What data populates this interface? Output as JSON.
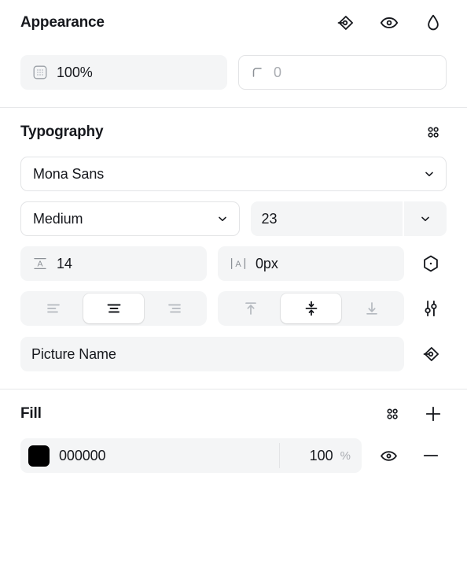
{
  "appearance": {
    "title": "Appearance",
    "actions": [
      {
        "name": "variable-icon",
        "label": "variable-token"
      },
      {
        "name": "eye-icon",
        "label": "visibility"
      },
      {
        "name": "droplet-icon",
        "label": "blend"
      }
    ],
    "opacity": {
      "icon": "opacity-grid-icon",
      "value": "100%"
    },
    "corner_radius": {
      "icon": "corner-radius-icon",
      "value": "0"
    }
  },
  "typography": {
    "title": "Typography",
    "actions": [
      {
        "name": "four-dot-grid-icon",
        "label": "styles"
      }
    ],
    "font_family": {
      "value": "Mona Sans",
      "chevron": "chevron-down-icon"
    },
    "font_weight": {
      "value": "Medium",
      "chevron": "chevron-down-icon"
    },
    "font_size": {
      "value": "23",
      "chevron": "chevron-down-icon"
    },
    "line_height": {
      "icon": "line-height-icon",
      "value": "14"
    },
    "letter_spacing": {
      "icon": "letter-spacing-icon",
      "value": "0px"
    },
    "type_settings_icon": "hexagon-dot-icon",
    "align_horizontal": {
      "options": [
        {
          "name": "align-left",
          "label": "Left"
        },
        {
          "name": "align-center",
          "label": "Center"
        },
        {
          "name": "align-right",
          "label": "Right"
        }
      ],
      "selected": 1
    },
    "align_vertical": {
      "options": [
        {
          "name": "align-top",
          "label": "Top"
        },
        {
          "name": "align-middle",
          "label": "Middle"
        },
        {
          "name": "align-bottom",
          "label": "Bottom"
        }
      ],
      "selected": 1
    },
    "align_settings_icon": "sliders-icon",
    "text_content": {
      "value": "Picture Name"
    },
    "text_variable_icon": "variable-icon"
  },
  "fill": {
    "title": "Fill",
    "actions": [
      {
        "name": "four-dot-grid-icon",
        "label": "styles"
      },
      {
        "name": "plus-icon",
        "label": "add-fill"
      }
    ],
    "layers": [
      {
        "color": "#000000",
        "hex": "000000",
        "opacity": "100",
        "opacity_unit": "%",
        "visibility_icon": "eye-icon",
        "remove_icon": "minus-icon"
      }
    ]
  },
  "colors": {
    "field_bg": "#f4f5f6",
    "border": "#e3e4e6",
    "divider": "#e6e7e9",
    "text": "#16181d",
    "muted": "#a9acb1"
  }
}
